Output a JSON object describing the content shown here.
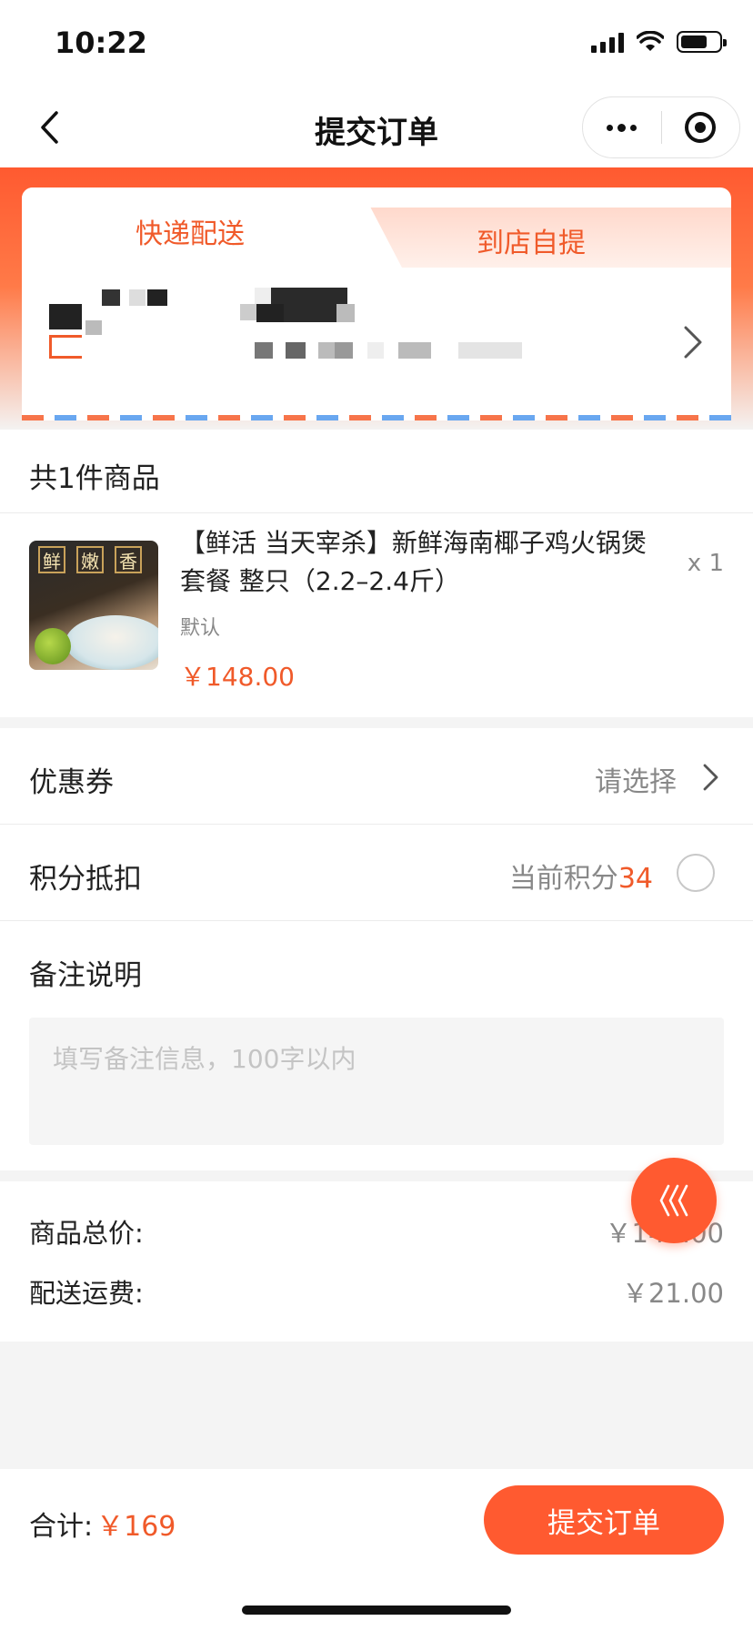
{
  "status_bar": {
    "time": "10:22"
  },
  "nav": {
    "title": "提交订单"
  },
  "delivery": {
    "tabs": [
      {
        "label": "快递配送",
        "active": true
      },
      {
        "label": "到店自提",
        "active": false
      }
    ]
  },
  "goods": {
    "count_label": "共1件商品",
    "items": [
      {
        "title": "【鲜活 当天宰杀】新鲜海南椰子鸡火锅煲套餐 整只（2.2–2.4斤）",
        "spec": "默认",
        "price": "￥148.00",
        "qty": "x 1",
        "thumb_badges": [
          "鲜",
          "嫩",
          "香"
        ]
      }
    ]
  },
  "coupon": {
    "label": "优惠券",
    "value": "请选择"
  },
  "points": {
    "label": "积分抵扣",
    "prefix": "当前积分",
    "value": "34"
  },
  "note": {
    "label": "备注说明",
    "placeholder": "填写备注信息，100字以内"
  },
  "pricing": {
    "goods_total_label": "商品总价:",
    "goods_total_value": "￥148.00",
    "shipping_label": "配送运费:",
    "shipping_value": "￥21.00"
  },
  "footer": {
    "total_label": "合计:",
    "total_value": "￥169",
    "submit_label": "提交订单"
  },
  "colors": {
    "accent": "#ff5a30",
    "price": "#f05a2a"
  }
}
